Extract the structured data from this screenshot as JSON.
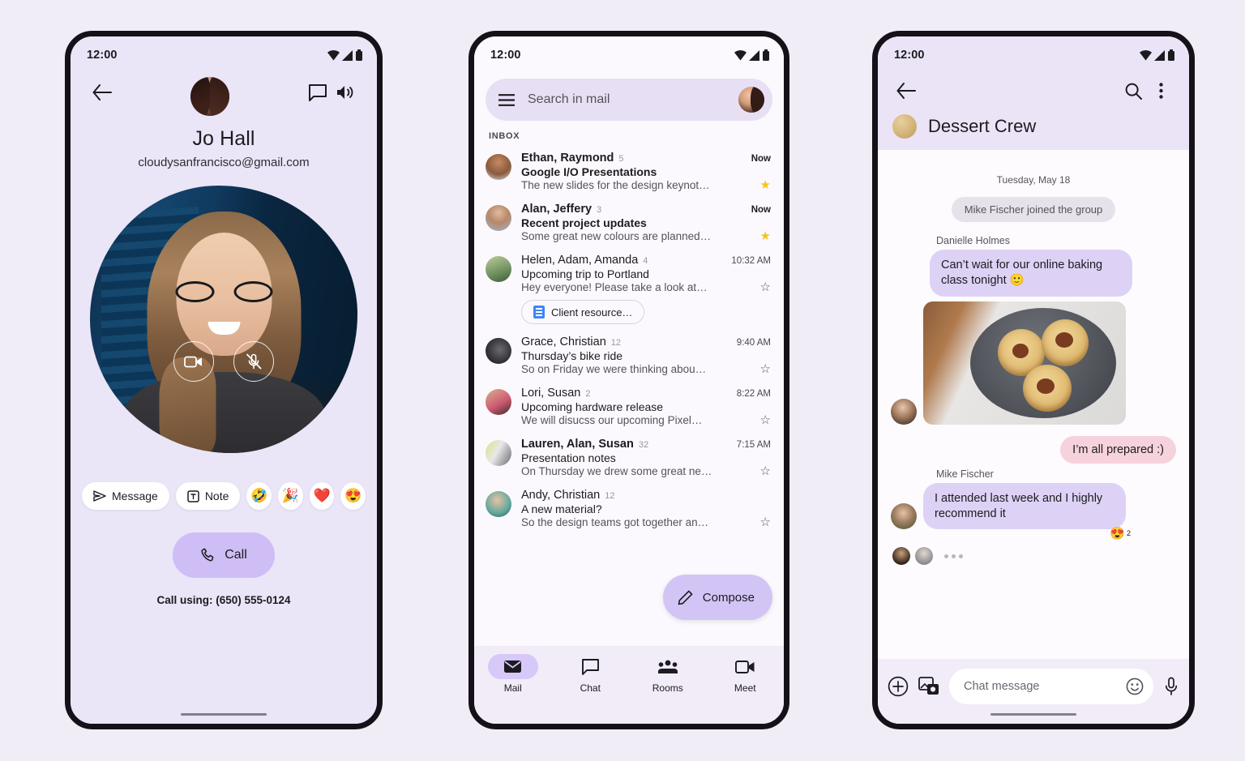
{
  "background_color": "#f1edf6",
  "phones": {
    "contact": {
      "status_bar": {
        "time": "12:00",
        "icons": [
          "wifi-icon",
          "signal-icon",
          "battery-icon"
        ]
      },
      "nav": {
        "back": "back-arrow-icon",
        "message": "chat-bubble-icon",
        "volume": "volume-up-icon"
      },
      "contact_name": "Jo Hall",
      "contact_email": "cloudysanfrancisco@gmail.com",
      "video_controls": [
        {
          "name": "video-camera-toggle",
          "icon": "video-camera-icon"
        },
        {
          "name": "microphone-toggle",
          "icon": "microphone-muted-icon"
        }
      ],
      "chips": [
        {
          "label": "Message",
          "icon": "send-icon"
        },
        {
          "label": "Note",
          "icon": "text-note-icon"
        }
      ],
      "emoji_chips": [
        "🤣",
        "🎉",
        "❤️",
        "😍"
      ],
      "call_button": {
        "label": "Call",
        "icon": "phone-icon",
        "color": "#cfbdf6"
      },
      "call_using": "Call using: (650) 555-0124"
    },
    "mail": {
      "status_bar": {
        "time": "12:00"
      },
      "search": {
        "placeholder": "Search in mail",
        "menu_icon": "hamburger-menu-icon",
        "avatar": "account-avatar"
      },
      "section_label": "INBOX",
      "threads": [
        {
          "from": "Ethan, Raymond",
          "count": "5",
          "time": "Now",
          "subject": "Google I/O Presentations",
          "snippet": "The new slides for the design keynot…",
          "unread": true,
          "starred": true,
          "attachment": null,
          "avatar_color": "#6d4a36"
        },
        {
          "from": "Alan, Jeffery",
          "count": "3",
          "time": "Now",
          "subject": "Recent project updates",
          "snippet": "Some great new colours are planned…",
          "unread": true,
          "starred": true,
          "attachment": null,
          "avatar_color": "#5d6b7d"
        },
        {
          "from": "Helen, Adam, Amanda",
          "count": "4",
          "time": "10:32 AM",
          "subject": "Upcoming trip to Portland",
          "snippet": "Hey everyone! Please take a look at…",
          "unread": false,
          "starred": false,
          "attachment": "Client resource…",
          "avatar_color": "#8a9a6e"
        },
        {
          "from": "Grace, Christian",
          "count": "12",
          "time": "9:40 AM",
          "subject": "Thursday’s bike ride",
          "snippet": "So on Friday we were thinking abou…",
          "unread": false,
          "starred": false,
          "attachment": null,
          "avatar_color": "#3a3a3c"
        },
        {
          "from": "Lori, Susan",
          "count": "2",
          "time": "8:22 AM",
          "subject": "Upcoming hardware release",
          "snippet": "We will disucss our upcoming Pixel…",
          "unread": false,
          "starred": false,
          "attachment": null,
          "avatar_color": "#c4566b"
        },
        {
          "from": "Lauren, Alan, Susan",
          "count": "32",
          "time": "7:15 AM",
          "subject": "Presentation notes",
          "snippet": "On Thursday we drew some great ne…",
          "unread": true,
          "starred": false,
          "attachment": null,
          "avatar_color": "#b9c77e"
        },
        {
          "from": "Andy, Christian",
          "count": "12",
          "time": "",
          "subject": "A new material?",
          "snippet": "So the design teams got together an…",
          "unread": false,
          "starred": false,
          "attachment": null,
          "avatar_color": "#4a8f86"
        }
      ],
      "compose": {
        "label": "Compose",
        "icon": "pencil-icon",
        "color": "#d3c4f6"
      },
      "bottom_nav": [
        {
          "label": "Mail",
          "icon": "envelope-icon",
          "active": true
        },
        {
          "label": "Chat",
          "icon": "chat-bubble-icon",
          "active": false
        },
        {
          "label": "Rooms",
          "icon": "people-group-icon",
          "active": false
        },
        {
          "label": "Meet",
          "icon": "video-camera-icon",
          "active": false
        }
      ]
    },
    "chat": {
      "status_bar": {
        "time": "12:00"
      },
      "nav": {
        "back": "back-arrow-icon",
        "search": "search-icon",
        "overflow": "more-vertical-icon"
      },
      "group_title": "Dessert Crew",
      "date_divider": "Tuesday, May 18",
      "system_message": "Mike Fischer joined the group",
      "messages": [
        {
          "type": "incoming",
          "sender": "Danielle Holmes",
          "text": "Can’t wait for our online baking class tonight 🙂",
          "has_image": true
        },
        {
          "type": "outgoing",
          "sender": "",
          "text": "I’m all prepared :)"
        },
        {
          "type": "incoming",
          "sender": "Mike Fischer",
          "text": "I attended last week and I highly recommend it",
          "reaction": {
            "emoji": "😍",
            "count": "2"
          }
        }
      ],
      "typing_indicator": "typing-dots",
      "input": {
        "placeholder": "Chat message",
        "add_icon": "plus-circle-icon",
        "image_icon": "image-picker-icon",
        "emoji_icon": "emoji-smile-icon",
        "mic_icon": "microphone-icon"
      }
    }
  }
}
